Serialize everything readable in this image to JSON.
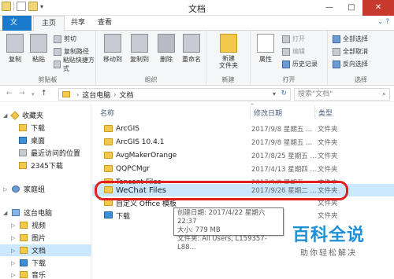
{
  "window": {
    "title": "文档",
    "buttons": [
      "—",
      "□",
      "✕"
    ]
  },
  "tabs": {
    "file": "文件",
    "home": "主页",
    "share": "共享",
    "view": "查看"
  },
  "ribbon": {
    "clipboard": {
      "label": "剪贴板",
      "copy": "复制",
      "paste": "粘贴",
      "cut": "剪切",
      "copy_path": "复制路径",
      "paste_shortcut": "粘贴快捷方式"
    },
    "organize": {
      "label": "组织",
      "move_to": "移动到",
      "copy_to": "复制到",
      "delete": "删除",
      "rename": "重命名"
    },
    "new": {
      "label": "新建",
      "new_folder": "新建\n文件夹"
    },
    "open": {
      "label": "打开",
      "properties": "属性",
      "open": "打开",
      "edit": "编辑",
      "history": "历史记录"
    },
    "select": {
      "label": "选择",
      "select_all": "全部选择",
      "select_none": "全部取消",
      "invert": "反向选择"
    }
  },
  "address": {
    "crumbs": [
      "这台电脑",
      "文档"
    ]
  },
  "search": {
    "placeholder": "搜索\"文档\""
  },
  "sidebar": {
    "favorites": "收藏夹",
    "items": [
      "下载",
      "桌面",
      "最近访问的位置",
      "2345下载"
    ],
    "homegroup": "家庭组",
    "this_pc": "这台电脑",
    "pc_items": [
      "视频",
      "图片",
      "文档",
      "下载",
      "音乐"
    ]
  },
  "columns": {
    "name": "名称",
    "date": "修改日期",
    "type": "类型"
  },
  "files": [
    {
      "name": "ArcGIS",
      "date": "2017/9/8 星期五 ...",
      "type": "文件夹"
    },
    {
      "name": "ArcGIS 10.4.1",
      "date": "2017/9/8 星期五 ...",
      "type": "文件夹"
    },
    {
      "name": "AvgMakerOrange",
      "date": "2017/8/25 星期五 ...",
      "type": "文件夹"
    },
    {
      "name": "QQPCMgr",
      "date": "2017/4/13 星期四 ...",
      "type": "文件夹"
    },
    {
      "name": "Tencent Files",
      "date": "2017/9/8 星期五 ...",
      "type": "文件夹"
    },
    {
      "name": "WeChat Files",
      "date": "2017/9/26 星期二 ...",
      "type": "文件夹"
    },
    {
      "name": "自定义 Office 模板",
      "date": "",
      "type": "文件夹"
    },
    {
      "name": "下载",
      "date": "",
      "type": "文件夹"
    }
  ],
  "tooltip": {
    "created": "创建日期: 2017/4/22 星期六 22:37",
    "size": "大小: 779 MB",
    "folders": "文件夹: All Users, L159357-L88..."
  },
  "watermark": {
    "logo": "百科全说",
    "sub": "助你轻松解决"
  },
  "colors": {
    "file_tab": "#1979ca",
    "highlight_ring": "#e0201e",
    "selection": "#cce8ff"
  }
}
